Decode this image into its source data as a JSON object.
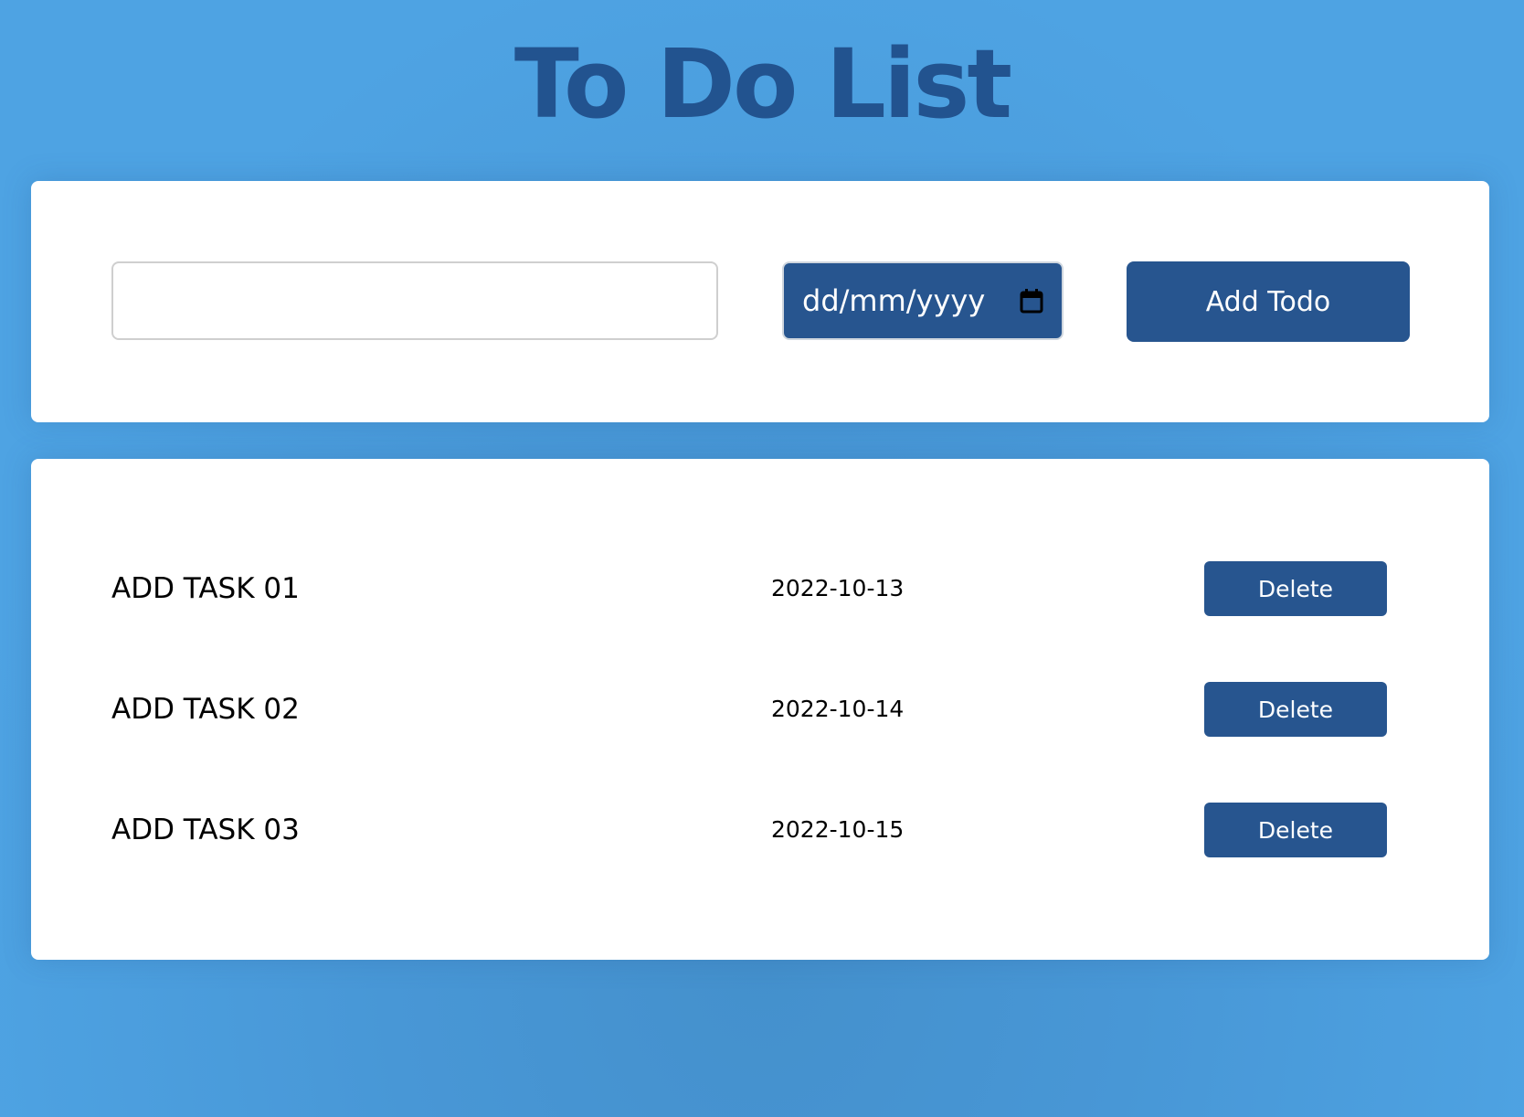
{
  "header": {
    "title": "To Do List"
  },
  "form": {
    "task_value": "",
    "date_placeholder": "dd/mm/yyyy",
    "add_label": "Add Todo"
  },
  "todos": [
    {
      "name": "ADD TASK 01",
      "date": "2022-10-13",
      "delete_label": "Delete"
    },
    {
      "name": "ADD TASK 02",
      "date": "2022-10-14",
      "delete_label": "Delete"
    },
    {
      "name": "ADD TASK 03",
      "date": "2022-10-15",
      "delete_label": "Delete"
    }
  ],
  "icons": {
    "date_picker": "calendar-icon"
  },
  "colors": {
    "background": "#4ea3e3",
    "title": "#22538f",
    "accent": "#27558f",
    "panel": "#ffffff",
    "text": "#000000"
  }
}
